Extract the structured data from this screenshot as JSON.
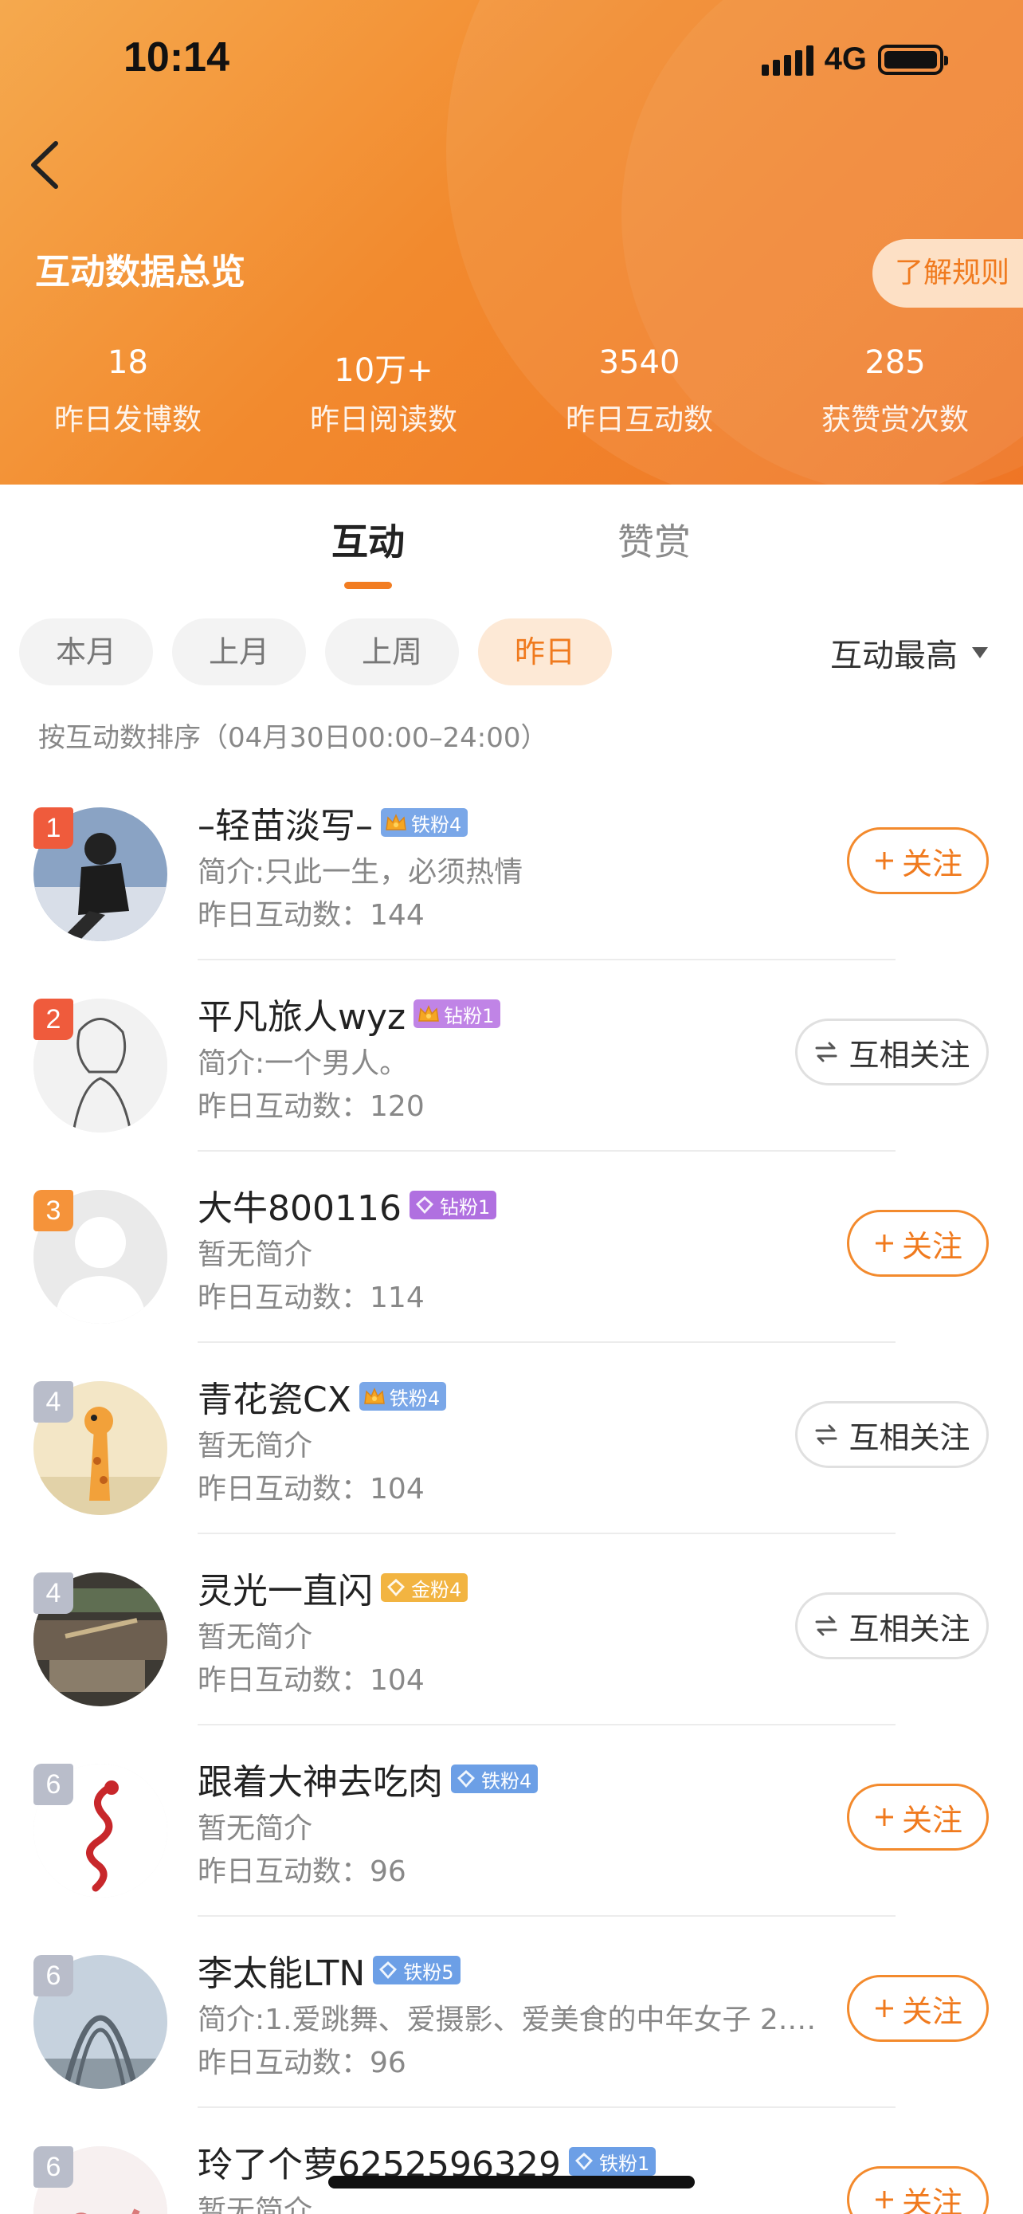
{
  "status_bar": {
    "time": "10:14",
    "network": "4G"
  },
  "header": {
    "title": "互动数据总览",
    "rules_button": "了解规则",
    "stats": [
      {
        "value": "18",
        "label": "昨日发博数"
      },
      {
        "value": "10万+",
        "label": "昨日阅读数"
      },
      {
        "value": "3540",
        "label": "昨日互动数"
      },
      {
        "value": "285",
        "label": "获赞赏次数"
      }
    ]
  },
  "tabs": [
    {
      "label": "互动",
      "active": true
    },
    {
      "label": "赞赏",
      "active": false
    }
  ],
  "filters": [
    {
      "label": "本月",
      "active": false
    },
    {
      "label": "上月",
      "active": false
    },
    {
      "label": "上周",
      "active": false
    },
    {
      "label": "昨日",
      "active": true
    }
  ],
  "sort_label": "互动最高",
  "sort_desc": "按互动数排序（04月30日00:00–24:00）",
  "colors": {
    "accent": "#f07a1e",
    "rank_top": "#ef5b3c",
    "rank_mid": "#f5933a",
    "rank_other": "#b9bdca"
  },
  "users": [
    {
      "rank": "1",
      "name": "–轻苗淡写–",
      "badge": "铁粉4",
      "badge_type": "iron-crown",
      "intro": "简介:只此一生，必须热情",
      "count_label": "昨日互动数：",
      "count": "144",
      "button": "关注",
      "button_type": "follow",
      "avatar": "figure"
    },
    {
      "rank": "2",
      "name": "平凡旅人wyz",
      "badge": "钻粉1",
      "badge_type": "diamond-crown",
      "intro": "简介:一个男人。",
      "count_label": "昨日互动数：",
      "count": "120",
      "button": "互相关注",
      "button_type": "mutual",
      "avatar": "sketch"
    },
    {
      "rank": "3",
      "name": "大牛800116",
      "badge": "钻粉1",
      "badge_type": "diamond",
      "intro": "暂无简介",
      "count_label": "昨日互动数：",
      "count": "114",
      "button": "关注",
      "button_type": "follow",
      "avatar": "default"
    },
    {
      "rank": "4",
      "name": "青花瓷CX",
      "badge": "铁粉4",
      "badge_type": "iron-crown",
      "intro": "暂无简介",
      "count_label": "昨日互动数：",
      "count": "104",
      "button": "互相关注",
      "button_type": "mutual",
      "avatar": "giraffe"
    },
    {
      "rank": "4",
      "name": "灵光一直闪",
      "badge": "金粉4",
      "badge_type": "gold",
      "intro": "暂无简介",
      "count_label": "昨日互动数：",
      "count": "104",
      "button": "互相关注",
      "button_type": "mutual",
      "avatar": "dark"
    },
    {
      "rank": "6",
      "name": "跟着大神去吃肉",
      "badge": "铁粉4",
      "badge_type": "iron",
      "intro": "暂无简介",
      "count_label": "昨日互动数：",
      "count": "96",
      "button": "关注",
      "button_type": "follow",
      "avatar": "dragon"
    },
    {
      "rank": "6",
      "name": "李太能LTN",
      "badge": "铁粉5",
      "badge_type": "iron",
      "intro": "简介:1.爱跳舞、爱摄影、爱美食的中年女子 2.…",
      "count_label": "昨日互动数：",
      "count": "96",
      "button": "关注",
      "button_type": "follow",
      "avatar": "arch"
    },
    {
      "rank": "6",
      "name": "玲了个萝6252596329",
      "badge": "铁粉1",
      "badge_type": "iron",
      "intro": "暂无简介",
      "count_label": "",
      "count": "",
      "button": "关注",
      "button_type": "follow",
      "avatar": "script"
    }
  ]
}
